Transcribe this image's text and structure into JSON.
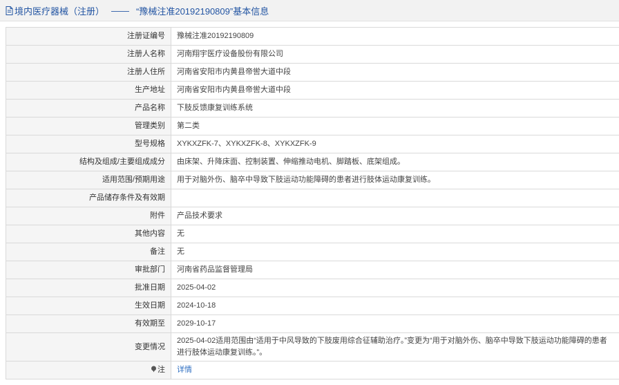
{
  "header": {
    "category": "境内医疗器械（注册）",
    "separator": "——",
    "record_title": "“豫械注准20192190809”基本信息"
  },
  "rows": [
    {
      "label": "注册证编号",
      "value": "豫械注准20192190809"
    },
    {
      "label": "注册人名称",
      "value": "河南翔宇医疗设备股份有限公司"
    },
    {
      "label": "注册人住所",
      "value": "河南省安阳市内黄县帝喾大道中段"
    },
    {
      "label": "生产地址",
      "value": "河南省安阳市内黄县帝喾大道中段"
    },
    {
      "label": "产品名称",
      "value": "下肢反馈康复训练系统"
    },
    {
      "label": "管理类别",
      "value": "第二类"
    },
    {
      "label": "型号规格",
      "value": "XYKXZFK-7、XYKXZFK-8、XYKXZFK-9"
    },
    {
      "label": "结构及组成/主要组成成分",
      "value": "由床架、升降床面、控制装置、伸缩推动电机、脚踏板、底架组成。"
    },
    {
      "label": "适用范围/预期用途",
      "value": "用于对脑外伤、脑卒中导致下肢运动功能障碍的患者进行肢体运动康复训练。"
    },
    {
      "label": "产品储存条件及有效期",
      "value": ""
    },
    {
      "label": "附件",
      "value": "产品技术要求"
    },
    {
      "label": "其他内容",
      "value": "无"
    },
    {
      "label": "备注",
      "value": "无"
    },
    {
      "label": "审批部门",
      "value": "河南省药品监督管理局"
    },
    {
      "label": "批准日期",
      "value": "2025-04-02"
    },
    {
      "label": "生效日期",
      "value": "2024-10-18"
    },
    {
      "label": "有效期至",
      "value": "2029-10-17"
    },
    {
      "label": "变更情况",
      "value": "2025-04-02适用范围由“适用于中风导致的下肢废用综合征辅助治疗。”变更为“用于对脑外伤、脑卒中导致下肢运动功能障碍的患者进行肢体运动康复训练。”。"
    }
  ],
  "note_row": {
    "label": "注",
    "link_text": "详情"
  },
  "colors": {
    "link": "#2f6fc2",
    "header_text": "#2355a3",
    "label_bg": "#f5f5f5",
    "border": "#d9d9d9"
  },
  "icons": {
    "header": "document-icon",
    "note": "note-pin-icon"
  }
}
